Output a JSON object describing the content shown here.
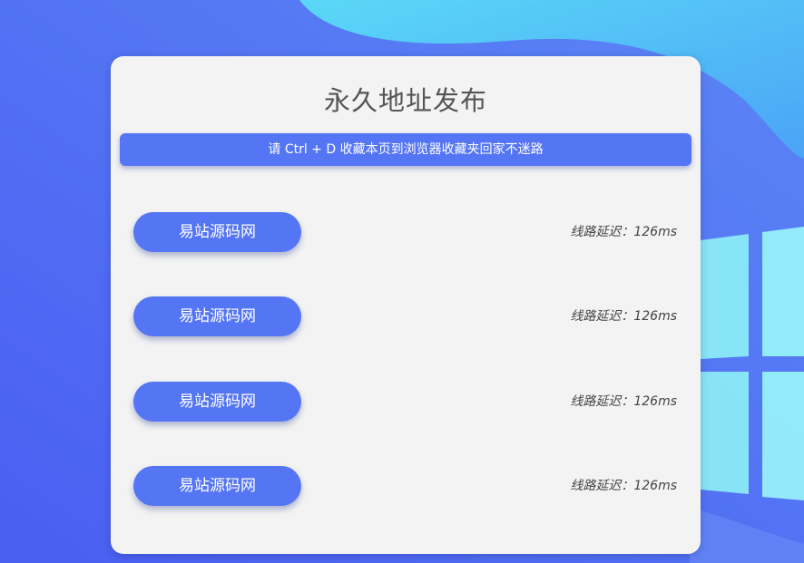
{
  "page": {
    "title": "永久地址发布",
    "notice": "请 Ctrl + D 收藏本页到浏览器收藏夹回家不迷路"
  },
  "lines": [
    {
      "label": "易站源码网",
      "latency": "线路延迟：126ms"
    },
    {
      "label": "易站源码网",
      "latency": "线路延迟：126ms"
    },
    {
      "label": "易站源码网",
      "latency": "线路延迟：126ms"
    },
    {
      "label": "易站源码网",
      "latency": "线路延迟：126ms"
    }
  ],
  "colors": {
    "accent": "#5576f4",
    "card": "#f3f3f3",
    "background": "#4f6cf0"
  }
}
